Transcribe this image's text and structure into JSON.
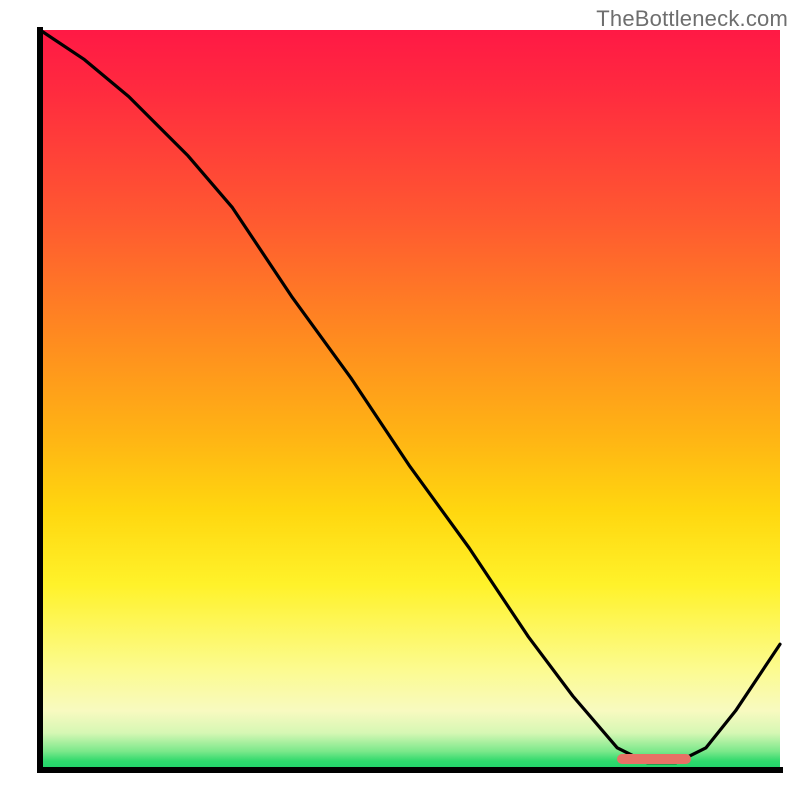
{
  "watermark": "TheBottleneck.com",
  "chart_data": {
    "type": "line",
    "title": "",
    "xlabel": "",
    "ylabel": "",
    "xlim": [
      0,
      100
    ],
    "ylim": [
      0,
      100
    ],
    "grid": false,
    "legend": false,
    "background_gradient": {
      "direction": "top-to-bottom",
      "stops": [
        {
          "pct": 0,
          "color": "#ff1945"
        },
        {
          "pct": 26,
          "color": "#ff5a30"
        },
        {
          "pct": 55,
          "color": "#ffb414"
        },
        {
          "pct": 75,
          "color": "#fff22a"
        },
        {
          "pct": 92,
          "color": "#f8fac0"
        },
        {
          "pct": 100,
          "color": "#1ed26a"
        }
      ]
    },
    "series": [
      {
        "name": "performance-curve",
        "x": [
          0,
          6,
          12,
          20,
          26,
          34,
          42,
          50,
          58,
          66,
          72,
          78,
          82,
          86,
          90,
          94,
          98,
          100
        ],
        "values": [
          100,
          96,
          91,
          83,
          76,
          64,
          53,
          41,
          30,
          18,
          10,
          3,
          1,
          1,
          3,
          8,
          14,
          17
        ]
      }
    ],
    "annotations": [
      {
        "name": "optimal-range-marker",
        "type": "bar",
        "x_start": 78,
        "x_end": 88,
        "y": 1,
        "color": "#e77165"
      }
    ]
  }
}
